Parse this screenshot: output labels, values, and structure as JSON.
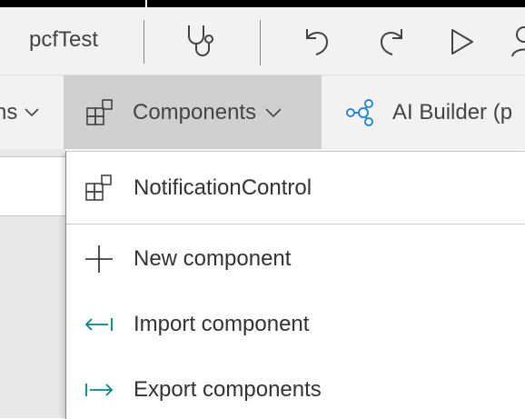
{
  "toolbar": {
    "app_title": "pcfTest",
    "icons": [
      "stethoscope-icon",
      "undo-icon",
      "redo-icon",
      "play-icon",
      "user-icon"
    ]
  },
  "ribbon": {
    "prev_tab_label": "ns",
    "components_label": "Components",
    "ai_builder_label": "AI Builder (p"
  },
  "menu": {
    "items": [
      {
        "label": "NotificationControl",
        "icon": "component-icon"
      },
      {
        "label": "New component",
        "icon": "plus-icon"
      },
      {
        "label": "Import component",
        "icon": "import-arrow-icon"
      },
      {
        "label": "Export components",
        "icon": "export-arrow-icon"
      }
    ]
  },
  "colors": {
    "accent_teal": "#038387",
    "ai_icon_blue": "#2b88d8",
    "selected_tab_bg": "#d2d0ce"
  }
}
